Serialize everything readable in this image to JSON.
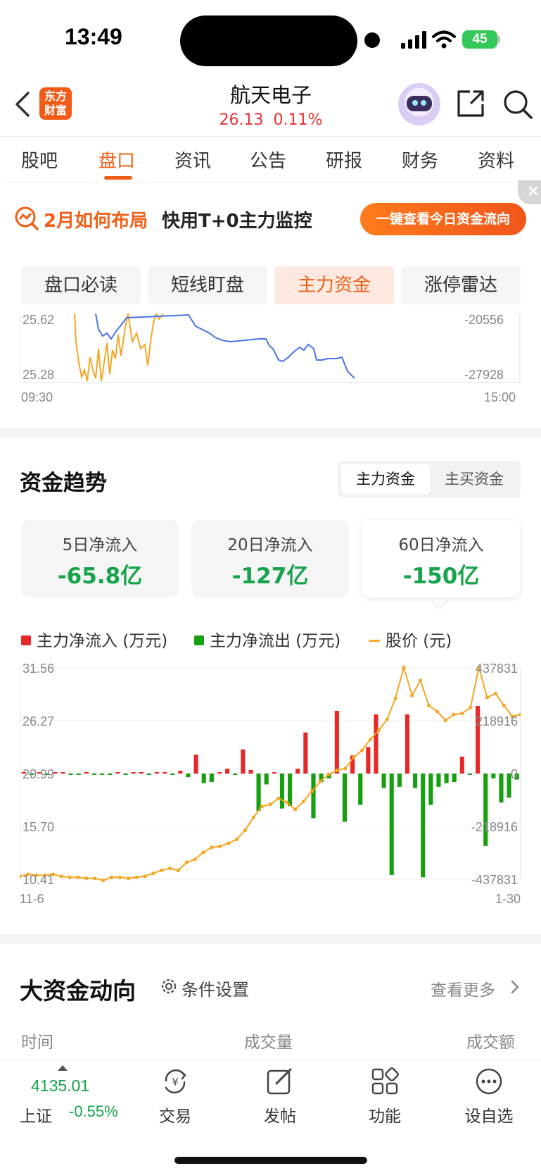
{
  "status_bar": {
    "time": "13:49",
    "battery": "45"
  },
  "header": {
    "logo_text": "东方财富",
    "stock_name": "航天电子",
    "price": "26.13",
    "change_pct": "0.11%"
  },
  "tabs": [
    {
      "label": "股吧",
      "active": false
    },
    {
      "label": "盘口",
      "active": true
    },
    {
      "label": "资讯",
      "active": false
    },
    {
      "label": "公告",
      "active": false
    },
    {
      "label": "研报",
      "active": false
    },
    {
      "label": "财务",
      "active": false
    },
    {
      "label": "资料",
      "active": false
    }
  ],
  "banner": {
    "title": "2月如何布局",
    "subtitle": "快用T+0主力监控",
    "button": "一键查看今日资金流向"
  },
  "sub_tabs": [
    {
      "label": "盘口必读",
      "active": false
    },
    {
      "label": "短线盯盘",
      "active": false
    },
    {
      "label": "主力资金",
      "active": true
    },
    {
      "label": "涨停雷达",
      "active": false
    }
  ],
  "intraday": {
    "left_ticks": [
      "25.62",
      "25.28"
    ],
    "right_ticks": [
      "-20556",
      "-27928"
    ],
    "time_start": "09:30",
    "time_end": "15:00"
  },
  "trend": {
    "title": "资金趋势",
    "toggle": [
      "主力资金",
      "主买资金"
    ],
    "cards": [
      {
        "label": "5日净流入",
        "value": "-65.8亿",
        "active": false
      },
      {
        "label": "20日净流入",
        "value": "-127亿",
        "active": false
      },
      {
        "label": "60日净流入",
        "value": "-150亿",
        "active": true
      }
    ],
    "legend": [
      {
        "label": "主力净流入 (万元)",
        "color": "#e62828"
      },
      {
        "label": "主力净流出 (万元)",
        "color": "#16a00f"
      },
      {
        "label": "股价 (元)",
        "color": "#f5a623"
      }
    ]
  },
  "chart_data": {
    "type": "bar",
    "x_start": "11-6",
    "x_end": "1-30",
    "price_axis": [
      31.56,
      26.27,
      20.99,
      15.7,
      10.41
    ],
    "flow_axis": [
      437831,
      218916,
      0,
      -218916,
      -437831
    ],
    "price_axis_labels": [
      "31.56",
      "26.27",
      "20.99",
      "15.70",
      "10.41"
    ],
    "flow_axis_labels": [
      "437831",
      "218916",
      "0",
      "-218916",
      "-437831"
    ],
    "series": [
      {
        "name": "主力净流入/流出 (万元)",
        "values": [
          2000,
          -3000,
          3000,
          -2000,
          4000,
          3000,
          -2000,
          -3000,
          2000,
          -4000,
          -2000,
          -3000,
          3000,
          -3000,
          4000,
          2000,
          -3000,
          4000,
          2000,
          -2000,
          12000,
          -15000,
          78000,
          -40000,
          -35000,
          5000,
          20000,
          -3000,
          100000,
          15000,
          -155000,
          -45000,
          3000,
          -145000,
          -135000,
          20000,
          170000,
          -185000,
          -35000,
          -20000,
          260000,
          -200000,
          75000,
          -130000,
          110000,
          245000,
          -60000,
          -420000,
          -55000,
          245000,
          -60000,
          -430000,
          -130000,
          -55000,
          -40000,
          -35000,
          70000,
          -5000,
          280000,
          -300000,
          -20000,
          -120000,
          -100000,
          -25000
        ],
        "color_rule": "positive red, negative green"
      },
      {
        "name": "股价 (元)",
        "values": [
          10.7,
          10.9,
          10.8,
          10.8,
          10.9,
          10.7,
          10.6,
          10.6,
          10.5,
          10.5,
          10.3,
          10.6,
          10.6,
          10.5,
          10.6,
          10.7,
          11.0,
          11.3,
          11.5,
          11.3,
          12.1,
          12.4,
          13.1,
          13.6,
          13.7,
          14.0,
          14.4,
          15.3,
          16.6,
          17.7,
          17.9,
          18.5,
          18.1,
          17.4,
          18.2,
          19.2,
          20.2,
          20.9,
          21.3,
          21.5,
          22.6,
          23.3,
          24.4,
          25.3,
          26.4,
          28.5,
          31.6,
          28.8,
          30.3,
          27.8,
          27.2,
          26.3,
          26.9,
          27.0,
          27.6,
          31.6,
          28.6,
          29.0,
          27.8,
          26.7,
          26.9
        ],
        "color": "#f5a623"
      }
    ]
  },
  "big_capital": {
    "title": "大资金动向",
    "condition": "条件设置",
    "more": "查看更多",
    "columns": [
      "时间",
      "成交量",
      "成交额"
    ]
  },
  "bottom_bar": {
    "index_value": "4135.01",
    "index_name": "上证",
    "index_change": "-0.55%",
    "items": [
      {
        "label": "交易",
        "icon": "yen-exchange-icon"
      },
      {
        "label": "发帖",
        "icon": "edit-post-icon"
      },
      {
        "label": "功能",
        "icon": "grid-apps-icon"
      },
      {
        "label": "设自选",
        "icon": "more-dots-icon"
      }
    ]
  }
}
